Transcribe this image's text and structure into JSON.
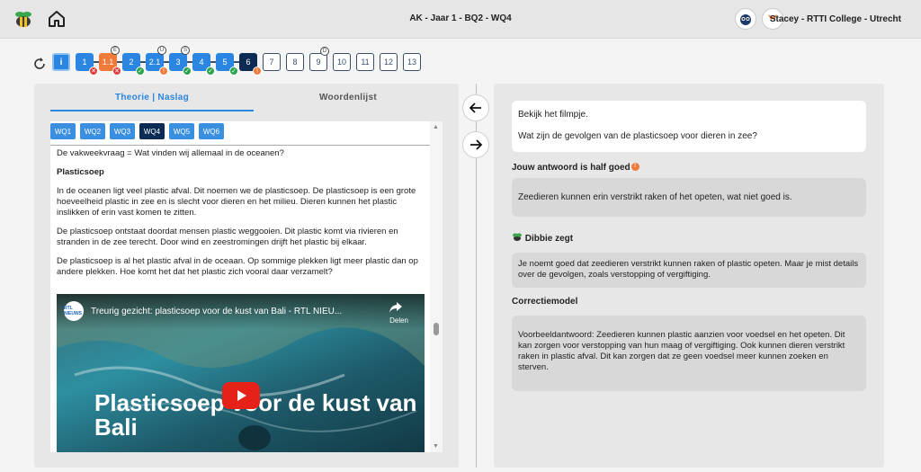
{
  "header": {
    "title": "AK - Jaar 1 - BQ2 - WQ4",
    "user": "Stacey - RTTI College - Utrecht"
  },
  "stepper": {
    "steps": [
      {
        "label": "1",
        "state": "blue",
        "badge": "red"
      },
      {
        "label": "1.1",
        "state": "orange",
        "badge": "red",
        "top": "E"
      },
      {
        "label": "2",
        "state": "blue",
        "badge": "green"
      },
      {
        "label": "2.1",
        "state": "blue",
        "badge": "orange",
        "top": "U"
      },
      {
        "label": "3",
        "state": "blue",
        "badge": "green",
        "top": "S"
      },
      {
        "label": "4",
        "state": "blue",
        "badge": "green"
      },
      {
        "label": "5",
        "state": "blue",
        "badge": "green"
      },
      {
        "label": "6",
        "state": "navy",
        "badge": "orange"
      },
      {
        "label": "7",
        "state": "empty"
      },
      {
        "label": "8",
        "state": "empty"
      },
      {
        "label": "9",
        "state": "empty",
        "top": "D"
      },
      {
        "label": "10",
        "state": "empty"
      },
      {
        "label": "11",
        "state": "empty"
      },
      {
        "label": "12",
        "state": "empty"
      },
      {
        "label": "13",
        "state": "empty"
      }
    ]
  },
  "left": {
    "tab_theorie": "Theorie | Naslag",
    "tab_woorden": "Woordenlijst",
    "wq_buttons": [
      "WQ1",
      "WQ2",
      "WQ3",
      "WQ4",
      "WQ5",
      "WQ6"
    ],
    "active_wq": "WQ4",
    "intro": "De vakweekvraag = Wat vinden wij allemaal in de oceanen?",
    "heading": "Plasticsoep",
    "p1": "In de oceanen ligt veel plastic afval. Dit noemen we de plasticsoep. De plasticsoep is een grote hoeveelheid plastic in zee en is slecht voor dieren en het milieu. Dieren kunnen het plastic inslikken of erin vast komen te zitten.",
    "p2": "De plasticsoep ontstaat doordat mensen plastic weggooien. Dit plastic komt via rivieren en stranden in de zee terecht. Door wind en zeestromingen drijft het plastic bij elkaar.",
    "p3": "De plasticsoep is al het plastic afval in de oceaan. Op sommige plekken ligt meer plastic dan op andere plekken. Hoe komt het dat het plastic zich vooral daar verzamelt?",
    "video": {
      "logo_text": "RTL NIEUWS",
      "title": "Treurig gezicht: plasticsoep voor de kust van Bali - RTL NIEU...",
      "share": "Delen",
      "overlay": "Plasticsoep voor de kust van Bali"
    }
  },
  "right": {
    "q1": "Bekijk het filmpje.",
    "q2": "Wat zijn de gevolgen van de plasticsoep voor dieren in zee?",
    "answer_heading": "Jouw antwoord is half goed",
    "answer": "Zeedieren kunnen erin verstrikt raken of het opeten, wat niet goed is.",
    "dibbie_heading": "Dibbie zegt",
    "dibbie": "Je noemt goed dat zeedieren verstrikt kunnen raken of plastic opeten. Maar je mist details over de gevolgen, zoals verstopping of vergiftiging.",
    "corr_heading": "Correctiemodel",
    "corr": "Voorbeeldantwoord: Zeedieren kunnen plastic aanzien voor voedsel en het opeten. Dit kan zorgen voor verstopping van hun maag of vergiftiging. Ook kunnen dieren verstrikt raken in plastic afval. Dit kan zorgen dat ze geen voedsel meer kunnen zoeken en sterven."
  },
  "colors": {
    "accent": "#2a86e0",
    "navy": "#0d2c55",
    "orange": "#f07a3a",
    "green": "#2aa34a",
    "red": "#e03a3a"
  }
}
